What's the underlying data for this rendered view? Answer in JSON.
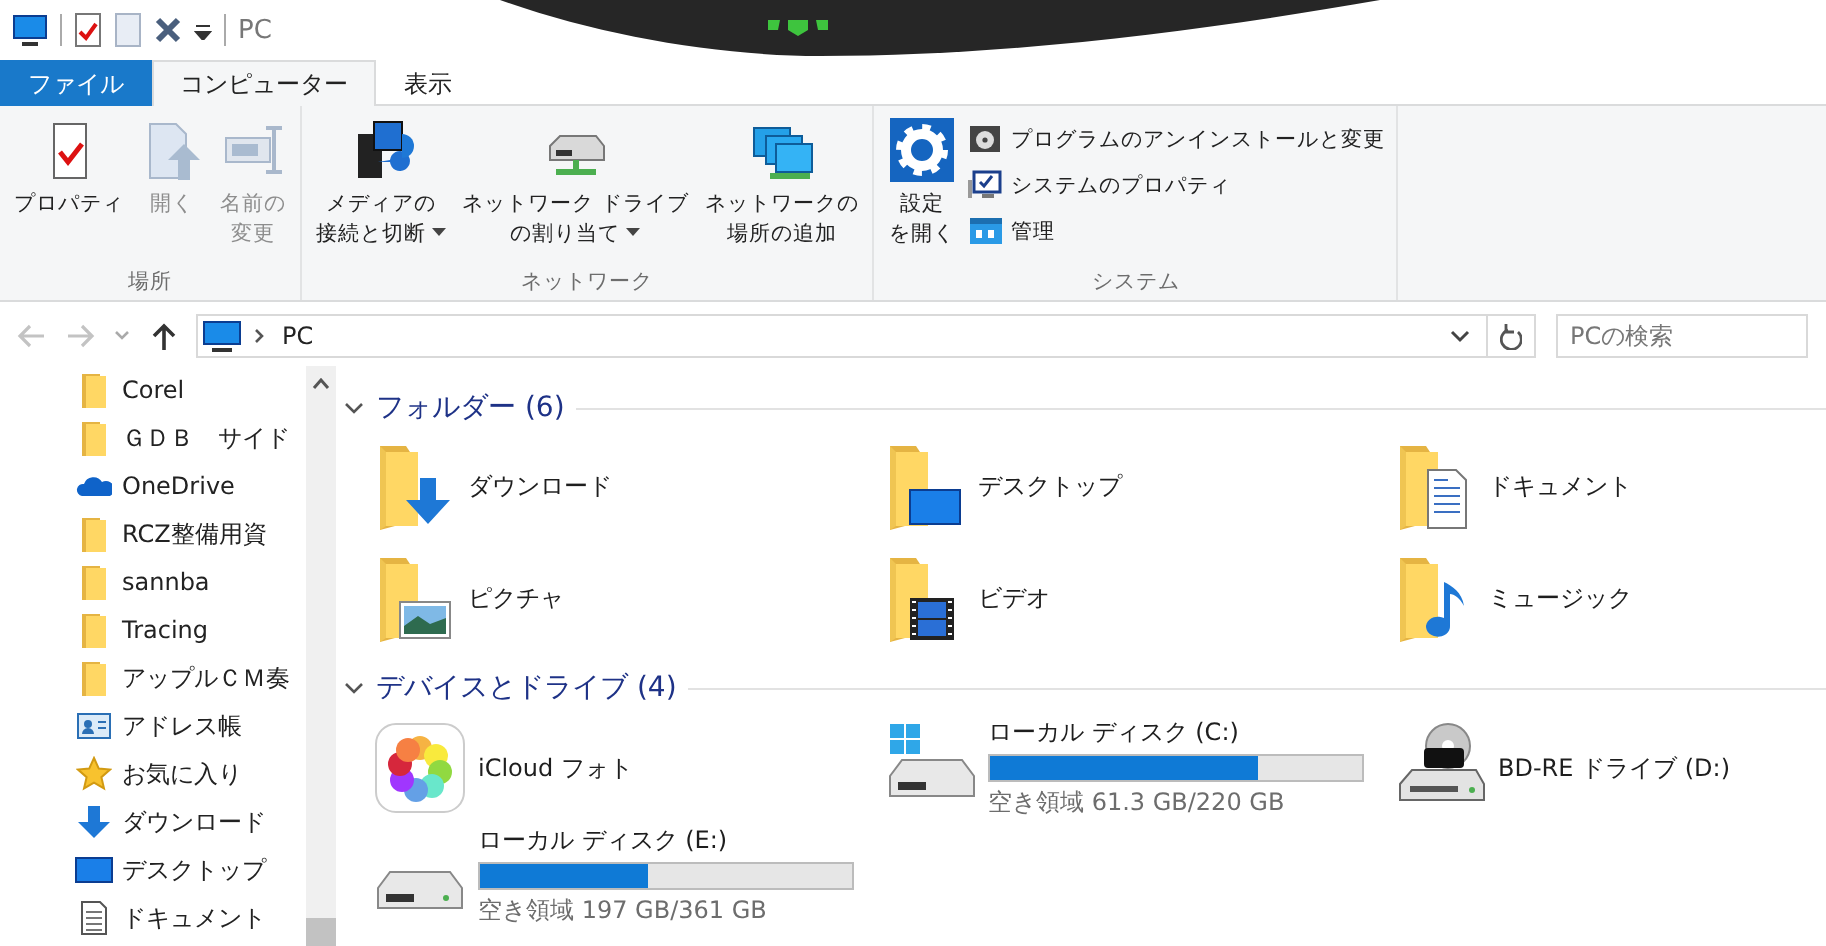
{
  "title_bar": {
    "title": "PC"
  },
  "ribbon": {
    "tabs": [
      {
        "label": "ファイル",
        "kind": "file",
        "selected": false
      },
      {
        "label": "コンピューター",
        "kind": "tab",
        "selected": true
      },
      {
        "label": "表示",
        "kind": "tab",
        "selected": false
      }
    ],
    "groups": [
      {
        "label": "場所",
        "commands": [
          {
            "kind": "properties",
            "lines": [
              "プロパティ"
            ],
            "disabled": false,
            "dropdown": false
          },
          {
            "kind": "open",
            "lines": [
              "開く"
            ],
            "disabled": true,
            "dropdown": false
          },
          {
            "kind": "rename",
            "lines": [
              "名前の",
              "変更"
            ],
            "disabled": true,
            "dropdown": false
          }
        ]
      },
      {
        "label": "ネットワーク",
        "commands": [
          {
            "kind": "media",
            "lines": [
              "メディアの",
              "接続と切断"
            ],
            "disabled": false,
            "dropdown": true
          },
          {
            "kind": "map-drive",
            "lines": [
              "ネットワーク ドライブ",
              "の割り当て"
            ],
            "disabled": false,
            "dropdown": true
          },
          {
            "kind": "network-place",
            "lines": [
              "ネットワークの",
              "場所の追加"
            ],
            "disabled": false,
            "dropdown": false
          }
        ]
      },
      {
        "label": "システム",
        "commands": [
          {
            "kind": "settings",
            "lines": [
              "設定",
              "を開く"
            ],
            "disabled": false,
            "dropdown": false
          }
        ],
        "small_commands": [
          {
            "kind": "uninstall",
            "label": "プログラムのアンインストールと変更"
          },
          {
            "kind": "system-properties",
            "label": "システムのプロパティ"
          },
          {
            "kind": "manage",
            "label": "管理"
          }
        ]
      }
    ]
  },
  "navigation": {
    "buttons": [
      {
        "kind": "back",
        "disabled": true
      },
      {
        "kind": "forward",
        "disabled": true
      },
      {
        "kind": "recent",
        "disabled": false
      },
      {
        "kind": "up",
        "disabled": false
      }
    ],
    "address": {
      "path": [
        "PC"
      ]
    },
    "search": {
      "placeholder": "PCの検索"
    }
  },
  "sidebar": {
    "items": [
      {
        "label": "Corel",
        "kind": "folder"
      },
      {
        "label": "ＧＤＢ　サイド",
        "kind": "folder"
      },
      {
        "label": "OneDrive",
        "kind": "onedrive"
      },
      {
        "label": "RCZ整備用資",
        "kind": "folder"
      },
      {
        "label": "sannba",
        "kind": "folder"
      },
      {
        "label": "Tracing",
        "kind": "folder"
      },
      {
        "label": "アップルＣＭ奏",
        "kind": "folder"
      },
      {
        "label": "アドレス帳",
        "kind": "contacts"
      },
      {
        "label": "お気に入り",
        "kind": "favorites"
      },
      {
        "label": "ダウンロード",
        "kind": "downloads"
      },
      {
        "label": "デスクトップ",
        "kind": "desktop"
      },
      {
        "label": "ドキュメント",
        "kind": "documents"
      }
    ]
  },
  "sections": [
    {
      "title": "フォルダー (6)",
      "expanded": true,
      "items": [
        {
          "label": "ダウンロード",
          "kind": "downloads"
        },
        {
          "label": "デスクトップ",
          "kind": "desktop"
        },
        {
          "label": "ドキュメント",
          "kind": "documents"
        },
        {
          "label": "ピクチャ",
          "kind": "pictures"
        },
        {
          "label": "ビデオ",
          "kind": "videos"
        },
        {
          "label": "ミュージック",
          "kind": "music"
        }
      ]
    },
    {
      "title": "デバイスとドライブ (4)",
      "expanded": true,
      "items": [
        {
          "label": "iCloud フォト",
          "kind": "photos"
        },
        {
          "label": "ローカル ディスク (C:)",
          "kind": "system-disk",
          "level": 0.72,
          "free": "空き領域 61.3 GB/220 GB"
        },
        {
          "label": "BD-RE ドライブ (D:)",
          "kind": "bd"
        },
        {
          "label": "ローカル ディスク (E:)",
          "kind": "disk",
          "level": 0.45,
          "free": "空き領域 197 GB/361 GB"
        }
      ]
    }
  ]
}
